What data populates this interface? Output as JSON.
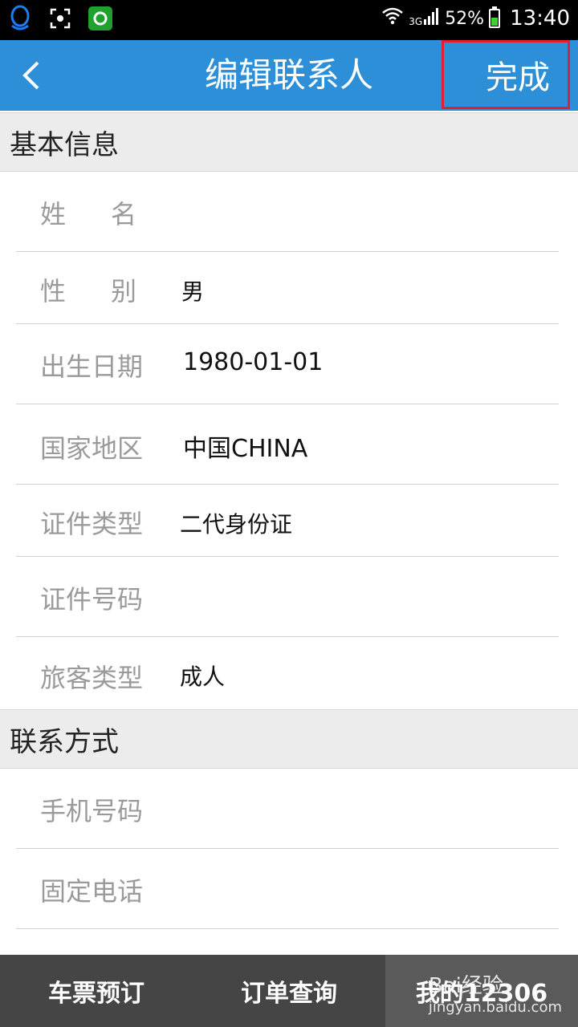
{
  "status_bar": {
    "battery": "52%",
    "network": "3G",
    "time": "13:40",
    "battery_color": "#3fd12f"
  },
  "title_bar": {
    "title": "编辑联系人",
    "done_label": "完成",
    "accent_color": "#2d8fd8",
    "highlight_color": "#e02030"
  },
  "basic_info": {
    "heading": "基本信息",
    "name_label": "姓名",
    "name_value": "",
    "gender_label": "性别",
    "gender_value": "男",
    "birth_label": "出生日期",
    "birth_value": "1980-01-01",
    "country_label": "国家地区",
    "country_value": "中国CHINA",
    "id_type_label": "证件类型",
    "id_type_value": "二代身份证",
    "id_number_label": "证件号码",
    "id_number_value": "",
    "passenger_type_label": "旅客类型",
    "passenger_type_value": "成人"
  },
  "contact": {
    "heading": "联系方式",
    "mobile_label": "手机号码",
    "mobile_value": "",
    "phone_label": "固定电话",
    "phone_value": ""
  },
  "tabs": [
    {
      "label": "车票预订"
    },
    {
      "label": "订单查询"
    },
    {
      "label": "我的12306"
    }
  ],
  "watermark": {
    "text": "Bai经验",
    "url": "jingyan.baidu.com"
  }
}
